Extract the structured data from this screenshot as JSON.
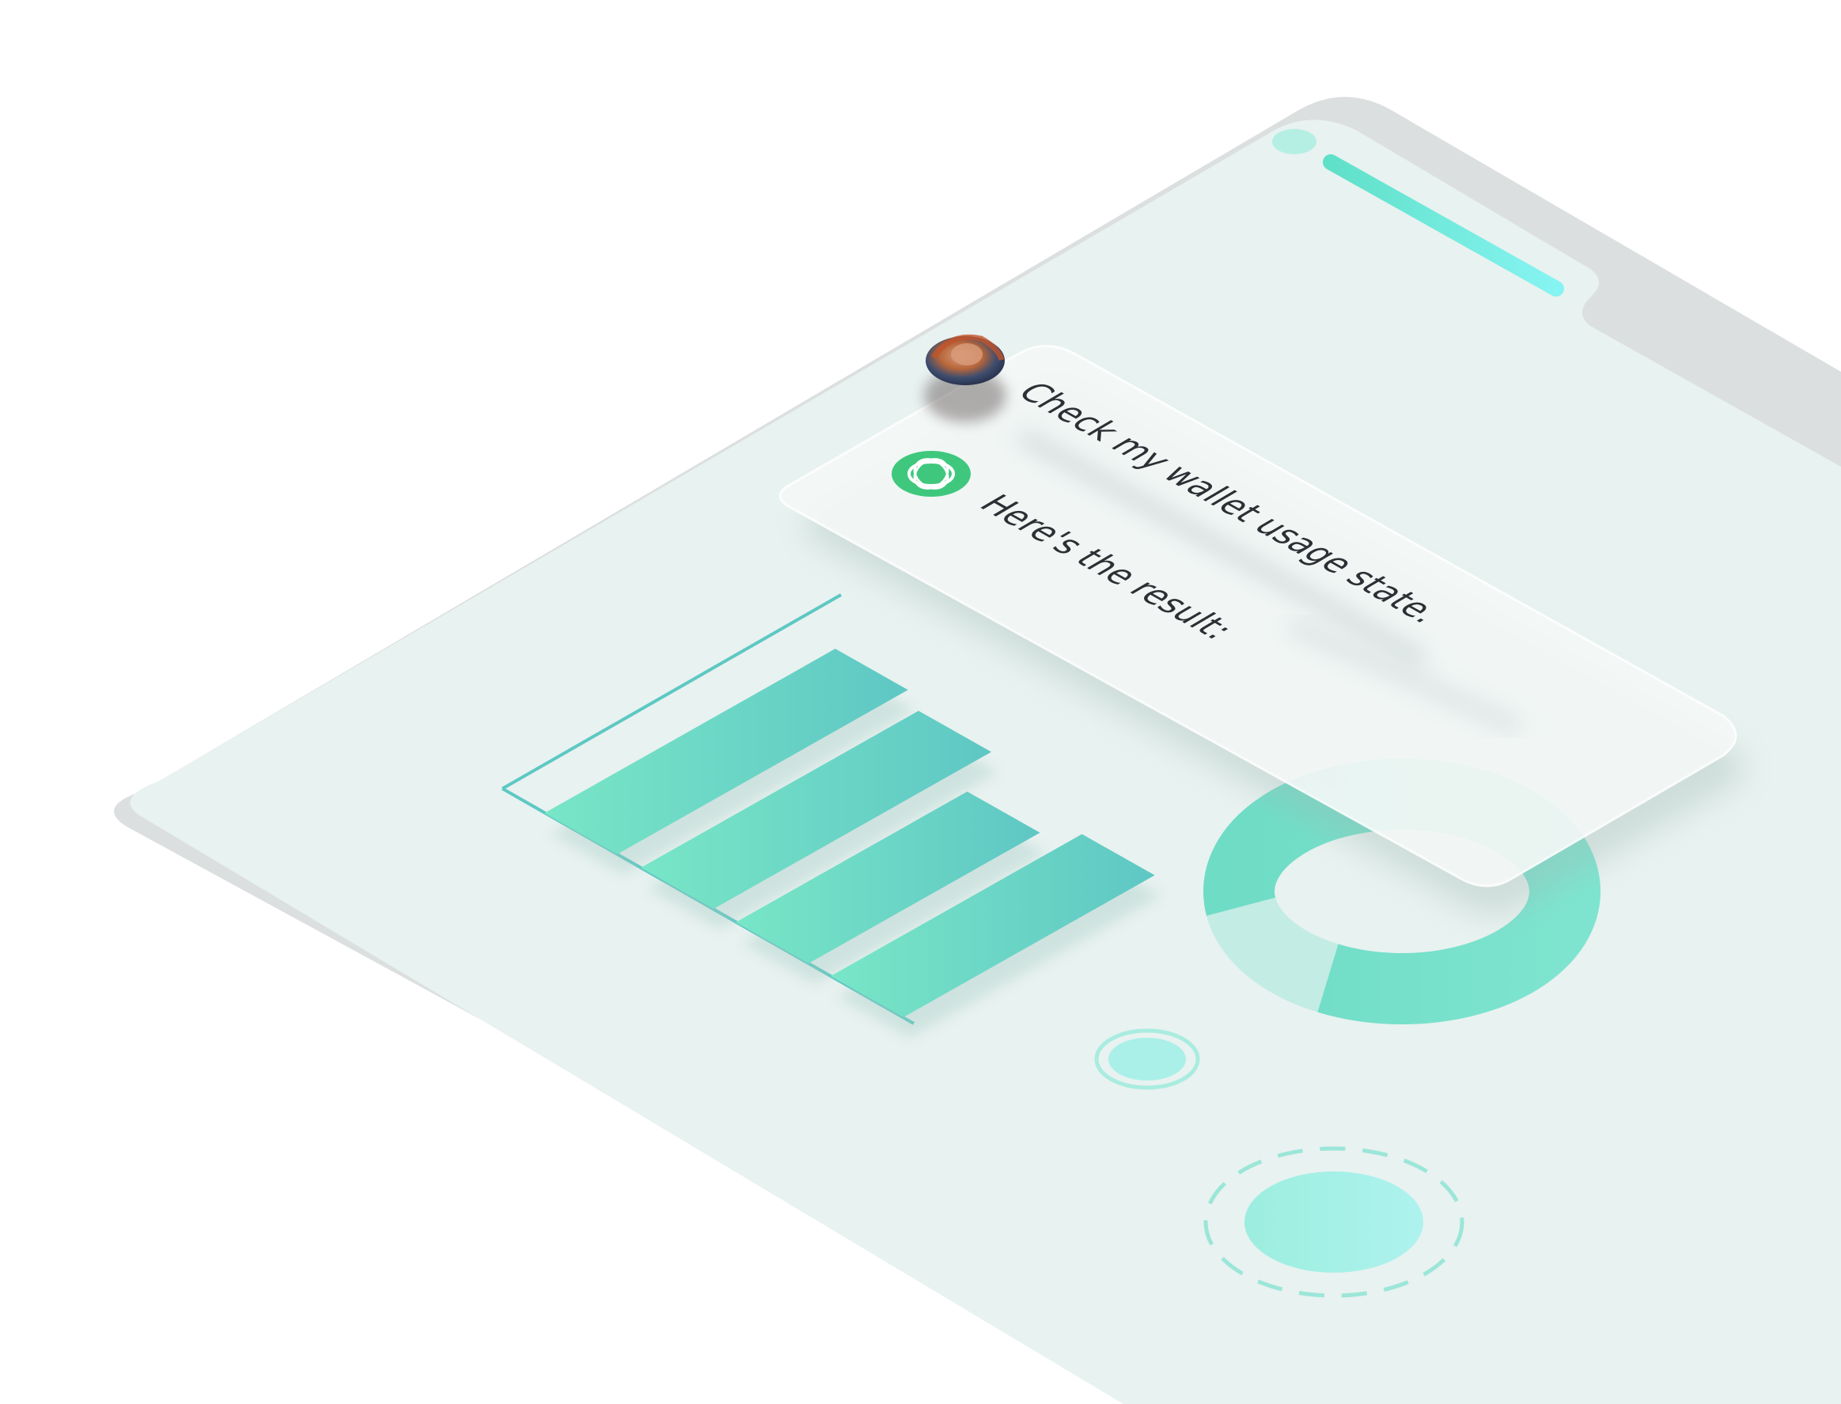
{
  "chat": {
    "user_message": "Check my wallet usage state.",
    "assistant_message": "Here's the result:"
  },
  "icons": {
    "user_avatar": "user-avatar",
    "assistant_avatar": "assistant-logo-icon"
  },
  "colors": {
    "device_surface": "#e8f2f0",
    "device_shadow": "#d9dcdc",
    "accent_teal": "#5ed8c4",
    "accent_cyan": "#7ff0ee",
    "bar_light": "#76e3c6",
    "bar_dark": "#62c8c4",
    "assistant_green": "#3fc87d",
    "text": "#2c2f33"
  },
  "progress_bar": {
    "fill_fraction": 1.0
  },
  "chart_data": {
    "type": "bar",
    "categories": [
      "",
      "",
      "",
      ""
    ],
    "values": [
      88,
      84,
      70,
      76
    ]
  },
  "donut": {
    "filled_fraction": 0.85
  }
}
